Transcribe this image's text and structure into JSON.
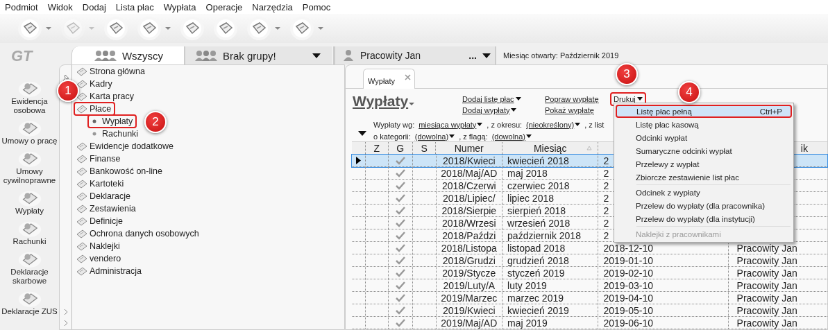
{
  "menu_bar": [
    "Podmiot",
    "Widok",
    "Dodaj",
    "Lista płac",
    "Wypłata",
    "Operacje",
    "Narzędzia",
    "Pomoc"
  ],
  "toolbar": [
    {
      "has_dropdown": true,
      "disabled": false
    },
    {
      "has_dropdown": true,
      "disabled": true
    },
    {
      "has_dropdown": false,
      "disabled": false
    },
    {
      "has_dropdown": true,
      "disabled": false
    },
    {
      "has_dropdown": false,
      "disabled": false
    },
    {
      "has_dropdown": false,
      "disabled": false
    },
    {
      "has_dropdown": true,
      "disabled": false
    },
    {
      "has_dropdown": true,
      "disabled": false
    }
  ],
  "logo": "GT",
  "nav": [
    "Ewidencja osobowa",
    "Umowy o pracę",
    "Umowy cywilnoprawne",
    "Wypłaty",
    "Rachunki",
    "Deklaracje skarbowe",
    "Deklaracje ZUS"
  ],
  "tabs": [
    {
      "label": "Wszyscy",
      "selected": true,
      "has_dropdown": false
    },
    {
      "label": "Brak grupy!",
      "selected": false,
      "has_dropdown": true
    }
  ],
  "employee": {
    "name": "Pracowity Jan",
    "more": "..."
  },
  "open_month": "Miesiąc otwarty:  Październik 2019",
  "tree": [
    {
      "label": "Strona główna"
    },
    {
      "label": "Kadry"
    },
    {
      "label": "Karta pracy"
    },
    {
      "label": "Płace",
      "callout": "1",
      "children": [
        {
          "label": "Wypłaty",
          "selected": true,
          "callout": "2"
        },
        {
          "label": "Rachunki",
          "selected": false
        }
      ]
    },
    {
      "label": "Ewidencje dodatkowe"
    },
    {
      "label": "Finanse"
    },
    {
      "label": "Bankowość on-line"
    },
    {
      "label": "Kartoteki"
    },
    {
      "label": "Deklaracje"
    },
    {
      "label": "Zestawienia"
    },
    {
      "label": "Definicje"
    },
    {
      "label": "Ochrona danych osobowych"
    },
    {
      "label": "Naklejki"
    },
    {
      "label": "vendero"
    },
    {
      "label": "Administracja"
    }
  ],
  "document_tab": {
    "label": "Wypłaty"
  },
  "page_title": "Wypłaty",
  "action_columns": [
    [
      {
        "label": "Dodaj listę płac",
        "dropdown": true
      },
      {
        "label": "Dodaj wypłaty",
        "dropdown": true
      }
    ],
    [
      {
        "label": "Popraw wypłatę",
        "dropdown": false
      },
      {
        "label": "Pokaż wypłatę",
        "dropdown": false
      }
    ],
    [
      {
        "label": "Drukuj",
        "dropdown": true,
        "callout": "3"
      }
    ]
  ],
  "filters": [
    [
      {
        "kind": "label",
        "text": "Wypłaty wg:"
      },
      {
        "kind": "link",
        "text": "miesiąca wypłaty"
      },
      {
        "kind": "label",
        "text": ", z okresu:"
      },
      {
        "kind": "link",
        "text": "(nieokreślony)"
      },
      {
        "kind": "label",
        "text": ", z list"
      }
    ],
    [
      {
        "kind": "label",
        "text": "o kategorii:"
      },
      {
        "kind": "link",
        "text": "(dowolna)"
      },
      {
        "kind": "label",
        "text": ", z flagą:"
      },
      {
        "kind": "link",
        "text": "(dowolna)"
      }
    ]
  ],
  "table": {
    "columns": [
      {
        "label": "Z"
      },
      {
        "label": "G"
      },
      {
        "label": "S"
      },
      {
        "label": "Numer"
      },
      {
        "label": "Miesiąc",
        "sorted": true
      },
      {},
      {
        "label": "ik"
      }
    ],
    "rows": [
      {
        "number": "2018/Kwieci",
        "month": "kwiecień 2018",
        "date": "2",
        "approved": true,
        "selected": true
      },
      {
        "number": "2018/Maj/AD",
        "month": "maj 2018",
        "date": "2",
        "approved": true,
        "selected": false
      },
      {
        "number": "2018/Czerwi",
        "month": "czerwiec 2018",
        "date": "2",
        "approved": true,
        "selected": false
      },
      {
        "number": "2018/Lipiec/",
        "month": "lipiec 2018",
        "date": "2",
        "approved": true,
        "selected": false
      },
      {
        "number": "2018/Sierpie",
        "month": "sierpień 2018",
        "date": "2",
        "approved": true,
        "selected": false
      },
      {
        "number": "2018/Wrzesi",
        "month": "wrzesień 2018",
        "date": "2",
        "approved": true,
        "selected": false
      },
      {
        "number": "2018/Paździ",
        "month": "październik 2018",
        "date": "2",
        "approved": true,
        "selected": false
      },
      {
        "number": "2018/Listopa",
        "month": "listopad 2018",
        "date": "2018-12-10",
        "person": "Pracowity Jan",
        "approved": true,
        "selected": false
      },
      {
        "number": "2018/Grudzi",
        "month": "grudzień 2018",
        "date": "2019-01-10",
        "person": "Pracowity Jan",
        "approved": true,
        "selected": false
      },
      {
        "number": "2019/Stycze",
        "month": "styczeń 2019",
        "date": "2019-02-10",
        "person": "Pracowity Jan",
        "approved": true,
        "selected": false
      },
      {
        "number": "2019/Luty/A",
        "month": "luty 2019",
        "date": "2019-03-10",
        "person": "Pracowity Jan",
        "approved": true,
        "selected": false
      },
      {
        "number": "2019/Marzec",
        "month": "marzec 2019",
        "date": "2019-04-10",
        "person": "Pracowity Jan",
        "approved": true,
        "selected": false
      },
      {
        "number": "2019/Kwieci",
        "month": "kwiecień 2019",
        "date": "2019-05-10",
        "person": "Pracowity Jan",
        "approved": true,
        "selected": false
      },
      {
        "number": "2019/Maj/AD",
        "month": "maj 2019",
        "date": "2019-06-10",
        "person": "Pracowity Jan",
        "approved": true,
        "selected": false
      }
    ]
  },
  "print_menu": [
    {
      "kind": "item",
      "label": "Listę płac pełną",
      "shortcut": "Ctrl+P",
      "selected": true,
      "disabled": false,
      "callout": "4"
    },
    {
      "kind": "item",
      "label": "Listę płac kasową",
      "selected": false,
      "disabled": false
    },
    {
      "kind": "item",
      "label": "Odcinki wypłat",
      "selected": false,
      "disabled": false
    },
    {
      "kind": "item",
      "label": "Sumaryczne odcinki wypłat",
      "selected": false,
      "disabled": false
    },
    {
      "kind": "item",
      "label": "Przelewy z wypłat",
      "selected": false,
      "disabled": false
    },
    {
      "kind": "item",
      "label": "Zbiorcze zestawienie list płac",
      "selected": false,
      "disabled": false
    },
    {
      "kind": "separator"
    },
    {
      "kind": "item",
      "label": "Odcinek z wypłaty",
      "selected": false,
      "disabled": false
    },
    {
      "kind": "item",
      "label": "Przelew do wypłaty (dla pracownika)",
      "selected": false,
      "disabled": false
    },
    {
      "kind": "item",
      "label": "Przelew do wypłaty (dla instytucji)",
      "selected": false,
      "disabled": false
    },
    {
      "kind": "separator"
    },
    {
      "kind": "item",
      "label": "Naklejki z pracownikami",
      "selected": false,
      "disabled": true
    }
  ]
}
